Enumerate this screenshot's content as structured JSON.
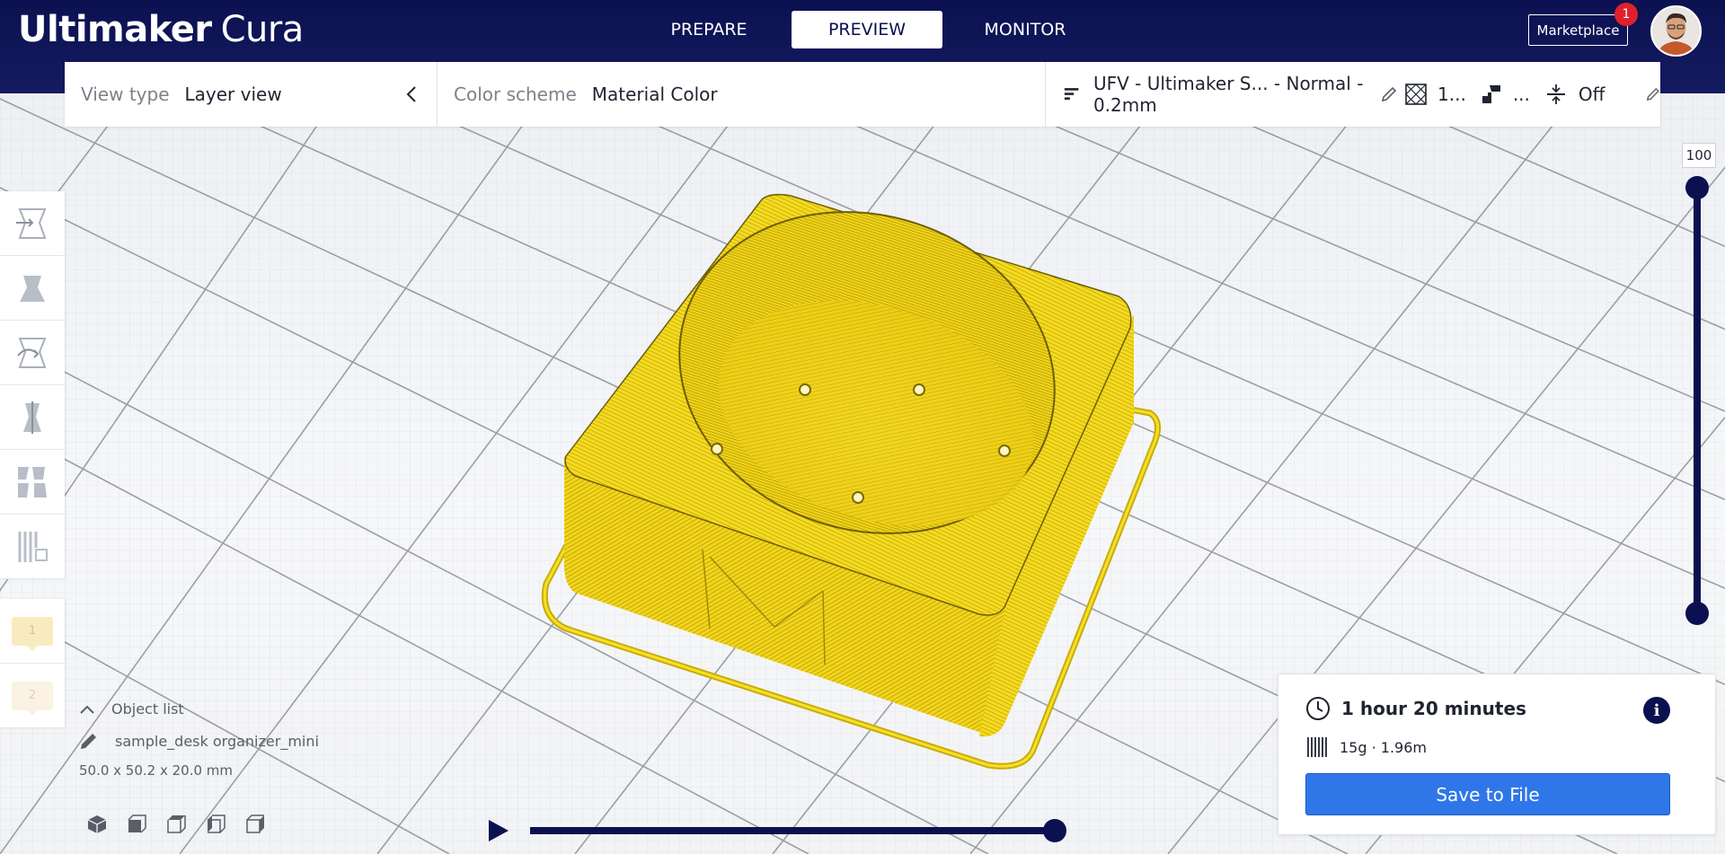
{
  "header": {
    "brand": "Ultimaker",
    "product": "Cura",
    "tabs": [
      {
        "label": "PREPARE",
        "active": false
      },
      {
        "label": "PREVIEW",
        "active": true
      },
      {
        "label": "MONITOR",
        "active": false
      }
    ],
    "marketplace_label": "Marketplace",
    "notification_count": "1"
  },
  "toolbar": {
    "view_type_label": "View type",
    "view_type_value": "Layer view",
    "color_scheme_label": "Color scheme",
    "color_scheme_value": "Material Color",
    "profile_value": "UFV - Ultimaker S... - Normal - 0.2mm",
    "infill_value": "1...",
    "support_value": "...",
    "adhesion_value": "Off"
  },
  "extruders": [
    {
      "label": "1"
    },
    {
      "label": "2"
    }
  ],
  "object_list": {
    "header": "Object list",
    "item_name": "sample_desk organizer_mini",
    "dimensions": "50.0 x 50.2 x 20.0 mm"
  },
  "layer_slider": {
    "current_layer": "100",
    "fraction": 1.0
  },
  "playback": {
    "progress": 1.0
  },
  "print_info": {
    "time": "1 hour 20 minutes",
    "material": "15g · 1.96m",
    "save_label": "Save to File"
  },
  "colors": {
    "header_bg": "#0b1150",
    "accent_blue": "#2f77e8",
    "filament_yellow": "#f2d314",
    "badge_red": "#e0212b"
  },
  "icons": {
    "tools": [
      "move-icon",
      "scale-icon",
      "rotate-icon",
      "mirror-icon",
      "per-model-settings-icon",
      "support-blocker-icon"
    ],
    "views": [
      "3d-view-icon",
      "front-view-icon",
      "top-view-icon",
      "left-view-icon",
      "right-view-icon"
    ]
  }
}
